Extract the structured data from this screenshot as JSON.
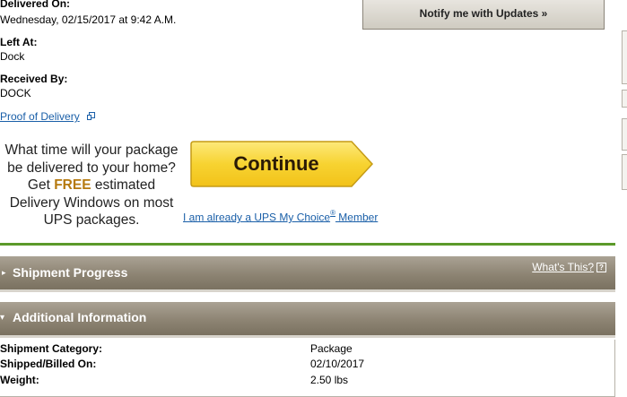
{
  "delivery": {
    "delivered_on_label": "Delivered On:",
    "delivered_on_value": "Wednesday,  02/15/2017 at 9:42 A.M.",
    "left_at_label": "Left At:",
    "left_at_value": "Dock",
    "received_by_label": "Received By:",
    "received_by_value": "DOCK",
    "proof_link": "Proof of Delivery"
  },
  "notify": {
    "button_label": "Notify me with Updates »"
  },
  "promo": {
    "line1": "What time will your package",
    "line2": "be delivered to your home?",
    "get": "Get ",
    "free": "FREE",
    "estimated": " estimated",
    "line4": "Delivery Windows on most",
    "line5": "UPS packages.",
    "continue_label": "Continue",
    "member_link_pre": "I am already a UPS My Choice",
    "member_link_reg": "®",
    "member_link_post": " Member"
  },
  "sections": {
    "shipment_progress": {
      "title": "Shipment Progress",
      "help_link": "What's This?",
      "help_icon": "?"
    },
    "additional_info": {
      "title": "Additional Information"
    }
  },
  "additional_info_rows": [
    {
      "label": "Shipment Category:",
      "value": "Package"
    },
    {
      "label": "Shipped/Billed On:",
      "value": "02/10/2017"
    },
    {
      "label": "Weight:",
      "value": "2.50 lbs"
    }
  ],
  "colors": {
    "accent_green": "#5b9a2a",
    "section_bar": "#8d8473",
    "continue_yellow": "#f7d331",
    "link_blue": "#1a5fa8",
    "free_orange": "#b5790f"
  }
}
